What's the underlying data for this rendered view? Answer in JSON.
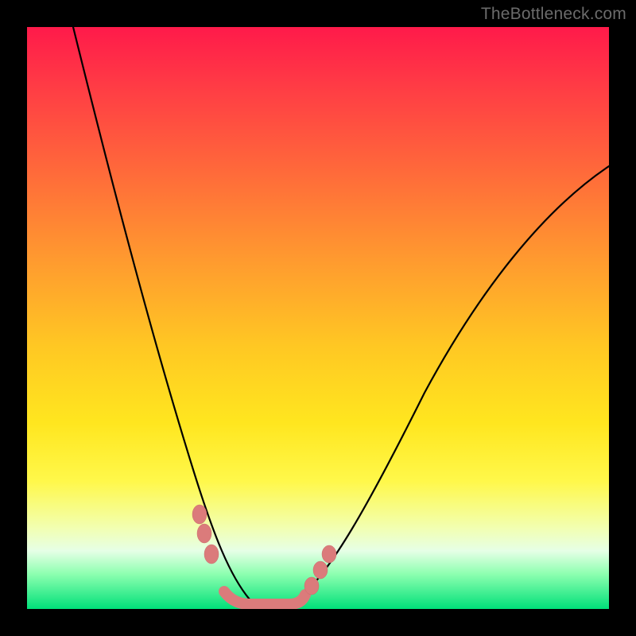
{
  "watermark": "TheBottleneck.com",
  "chart_data": {
    "type": "line",
    "title": "",
    "xlabel": "",
    "ylabel": "",
    "xlim": [
      0,
      1
    ],
    "ylim": [
      0,
      1
    ],
    "background_gradient": {
      "orientation": "vertical",
      "stops": [
        {
          "pos": 0.0,
          "color": "#ff1a4a"
        },
        {
          "pos": 0.25,
          "color": "#ff6a3a"
        },
        {
          "pos": 0.55,
          "color": "#ffc823"
        },
        {
          "pos": 0.78,
          "color": "#fff84a"
        },
        {
          "pos": 0.94,
          "color": "#8dffb0"
        },
        {
          "pos": 1.0,
          "color": "#00e079"
        }
      ]
    },
    "series": [
      {
        "name": "bottleneck-curve",
        "color": "#000000",
        "x": [
          0.08,
          0.12,
          0.16,
          0.2,
          0.24,
          0.27,
          0.3,
          0.33,
          0.36,
          0.4,
          0.44,
          0.5,
          0.56,
          0.62,
          0.7,
          0.8,
          0.9,
          1.0
        ],
        "y": [
          1.0,
          0.83,
          0.66,
          0.5,
          0.34,
          0.22,
          0.12,
          0.05,
          0.01,
          0.0,
          0.01,
          0.06,
          0.14,
          0.24,
          0.38,
          0.54,
          0.66,
          0.76
        ]
      }
    ],
    "markers": {
      "name": "scatter-points",
      "color": "#db7b7b",
      "points": [
        {
          "x": 0.29,
          "y": 0.15
        },
        {
          "x": 0.3,
          "y": 0.12
        },
        {
          "x": 0.312,
          "y": 0.085
        },
        {
          "x": 0.485,
          "y": 0.03
        },
        {
          "x": 0.5,
          "y": 0.058
        },
        {
          "x": 0.515,
          "y": 0.085
        }
      ]
    },
    "trough_highlight": {
      "name": "trough-band",
      "color": "#db7b7b",
      "x_range": [
        0.33,
        0.46
      ],
      "y": 0.0
    }
  }
}
